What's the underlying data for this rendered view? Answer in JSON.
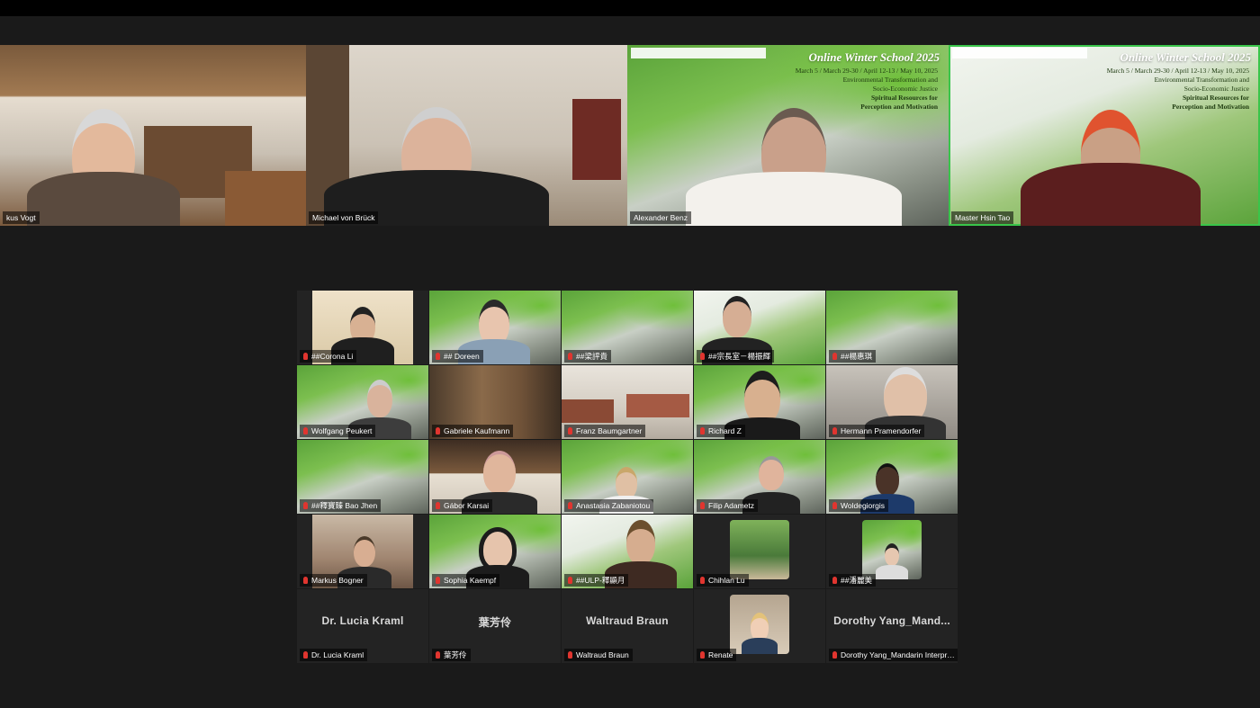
{
  "banner": {
    "title": "Online Winter School 2025",
    "dates": "March 5 / March 29-30 / April 12-13 / May 10, 2025",
    "subtitle_line1": "Environmental Transformation and",
    "subtitle_line2": "Socio-Economic Justice",
    "subtitle_line3": "Spiritual Resources for",
    "subtitle_line4": "Perception and Motivation"
  },
  "speakers": [
    {
      "name": "kus Vogt"
    },
    {
      "name": "Michael von Brück"
    },
    {
      "name": "Alexander Benz"
    },
    {
      "name": "Master Hsin Tao"
    }
  ],
  "gallery": [
    {
      "name": "##Corona Li"
    },
    {
      "name": "## Doreen"
    },
    {
      "name": "##梁評貴"
    },
    {
      "name": "##宗長室－楊振輝"
    },
    {
      "name": "##楊惠琪"
    },
    {
      "name": "Wolfgang Peukert"
    },
    {
      "name": "Gabriele Kaufmann"
    },
    {
      "name": "Franz Baumgartner"
    },
    {
      "name": "Richard Z"
    },
    {
      "name": "Hermann Pramendorfer"
    },
    {
      "name": "##釋寶臻 Bao Jhen"
    },
    {
      "name": "Gábor Karsai"
    },
    {
      "name": "Anastasia Zabaniotou"
    },
    {
      "name": "Filip Adametz"
    },
    {
      "name": "Woldegiorgis"
    },
    {
      "name": "Markus Bogner"
    },
    {
      "name": "Sophia Kaempf"
    },
    {
      "name": "##ULP-釋顯月"
    },
    {
      "name": "Chihlan Lu"
    },
    {
      "name": "##潘麗美"
    },
    {
      "name": "Dr. Lucia Kraml",
      "placeholder": "Dr. Lucia Kraml"
    },
    {
      "name": "葉芳伶",
      "placeholder": "葉芳伶"
    },
    {
      "name": "Waltraud Braun",
      "placeholder": "Waltraud Braun"
    },
    {
      "name": "Renate"
    },
    {
      "name": "Dorothy Yang_Mandarin Interpre...",
      "placeholder": "Dorothy Yang_Mand..."
    }
  ],
  "colors": {
    "active_speaker_border": "#39c54a",
    "muted_mic": "#e0352f",
    "background": "#1a1a1a"
  }
}
